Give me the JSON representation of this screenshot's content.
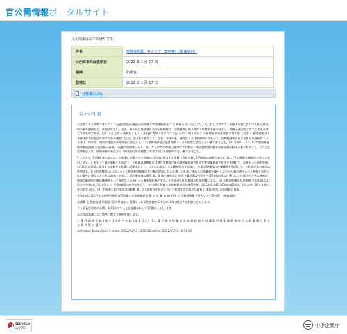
{
  "header": {
    "title_part1": "官公需情報",
    "title_part2": "ポータルサイト"
  },
  "intro": "入札情報は以下の通りです。",
  "info_table": [
    {
      "key": "件名",
      "value": "労務提供業（官大ツアー案内等）（単価契約）",
      "is_link": true
    },
    {
      "key": "公示日または更新日",
      "value": "2022 年 1 月 17 日",
      "is_link": false
    },
    {
      "key": "組織",
      "value": "防衛省",
      "is_link": false
    },
    {
      "key": "取得日",
      "value": "2022 年 1 月 17 日",
      "is_link": false
    }
  ],
  "spec_label": "仕様書のURL",
  "content": {
    "title": "公示内容",
    "paragraphs": [
      "公告第１８号令和４年１月１４日支出負担行為担当官防衛大学校総務部長 二又 知恵公 告下記により入札に付しますので、防衛大学校における入札及び契約の事を開始のと、参加されたい。なお、本入札に係る落札及び契約締結は、当該業務に係る令和４年度本予算の成立し、予算示達がなされることを条件とするものである。記１ 入札方式 一般競争入札２ 入札日時 令和４年２月２２日(火)１１時００分３ 入札場所 防衛大学校本館１階 入札室４ 参加資格 (1) 予算決算及び会計令第７０条の規定に該当しない者であること。なお、未成年者、被保佐人又は被補助人であって、契約締結のために必要な同意を得ている者は、同条中、特別の理由がある場合に該当する。(2) 予算決算及び会計令第７１条の規定に該当しない者であること。(3) 令和01・02・03年度防衛省競争参加資格(全省庁統一資格)「役務の提供等」のＡ、Ｂ、Ｃ又はＤの等級に格付けされ関東・甲信越地域の競争参加資格を有する者であること。(4) 大臣官房長官又は、防衛装備庁長官から「指名停止等の措置」を受けている期間中でない者であること。",
      "5 入札方法 (1) 落札者の決定は、入札書に記載された金額の110%に相当する金額（当該金額に1円未満の端数があるときは、その端数金額を切り捨てるものとする。）をもって落札価格とするので、入札者は消費税及び地方消費税に係る課税事業者であるか免税事業者であるかを問わず、見積もった契約金額の110分の100に相当する金額を入札書に記載すること。(2) 入札者は、入札書を提出する際に、入札説明書及び仕様書等を熟読の上、入札保証金の納付は免除する。6 入札の無効 本公告に示した競争参加資格のない者の提出した入札書、入札者に求められる義務を履行しなかった者の提出した入札書その他入札の条件に違反した入札は無効とする。7 契約書作成の要否 要。8 落札者の決定方法 予算決算及び会計令第79条の規定に基づいて作成された予定価格の制限の範囲内で最低価格をもって有効な入札を行った者を落札者とする。9 その他 (1) 詳細は入札説明書による。(2) 入札説明書の交付期間 令和4年1月17日から令和4年2月14日まで（行政機関の休日を除く）、交付場所 防衛大学校総務部会計課契約係、電話046-841-3810内線2094。(3) 本件に関する問い合わせ先 同上。(4) 手続きにおける交渉の有無 無。(5) 契約の手続きにおいて使用する言語及び通貨 日本語及び日本国通貨に限る。",
      "令和4年2月22日支出負担行為担当官防衛大学校総務部長 殿 入 札 書 金 額 ¥ 件 名 労務提供業（官大ツアー案内等）（単価契約）",
      "金額欄 長 物価各部 防衛部 契約 単価 は、見積もった契約金額の110分の100に相当する金額を記入します。",
      "「入札及び契約の心得」を承諾の うえ上記金額をもって見積り(入札)します。",
      "なお次の条項により談合に関する誓約を致します。",
      "1. 履 行 期 間 令 和 4 年 4 月 1 日 ～ 令 和 5 年 3 月 3 1 日 2. 履 行 場 所 防 衛 大 学 校 総 務 部 会 計 課 契 約 係 3. 納 期 係 自 ら 入 札 事 項 に 関 す る 条 件 等 の 遵 守",
      "soft_label: Epson Scan 2 ctime: 2022/01/13 13:56:25 mtime: 2022/01/14 16:51:01"
    ]
  },
  "footer": {
    "jpki_line1": "SECURED",
    "jpki_line2": "by JPRS",
    "agency_name": "中小企業庁"
  }
}
